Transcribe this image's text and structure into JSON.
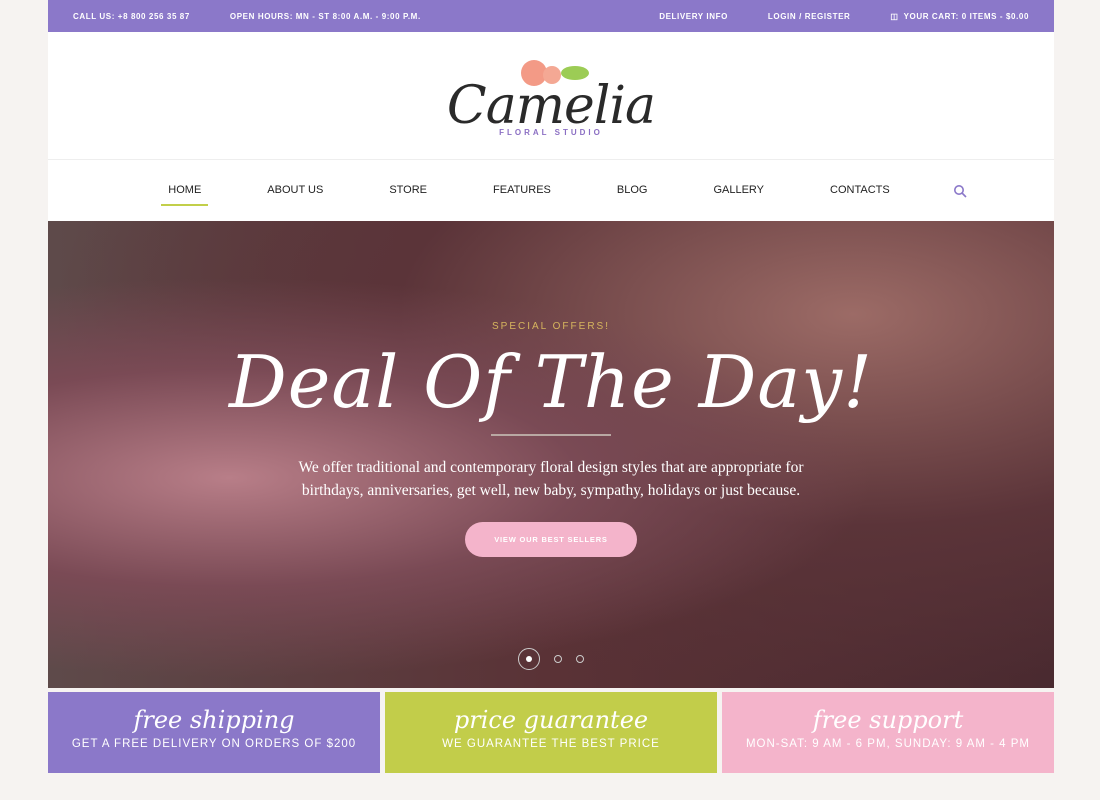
{
  "topbar": {
    "phone": "CALL US: +8 800 256 35 87",
    "hours": "OPEN HOURS: MN - ST 8:00 A.M. - 9:00 P.M.",
    "delivery": "DELIVERY INFO",
    "login": "LOGIN / REGISTER",
    "cart": "YOUR CART:  0 ITEMS - $0.00"
  },
  "logo": {
    "name": "Camelia",
    "tagline": "FLORAL STUDIO"
  },
  "nav": {
    "items": [
      {
        "label": "HOME"
      },
      {
        "label": "ABOUT US"
      },
      {
        "label": "STORE"
      },
      {
        "label": "FEATURES"
      },
      {
        "label": "BLOG"
      },
      {
        "label": "GALLERY"
      },
      {
        "label": "CONTACTS"
      }
    ]
  },
  "hero": {
    "pre": "SPECIAL OFFERS!",
    "title": "Deal Of The Day!",
    "text": "We offer traditional and contemporary floral design styles that are appropriate for birthdays, anniversaries, get well, new baby, sympathy, holidays or just because.",
    "button": "VIEW OUR BEST SELLERS",
    "slides": 3,
    "active_slide": 1
  },
  "features": [
    {
      "title": "free shipping",
      "desc": "GET A FREE DELIVERY ON ORDERS OF $200",
      "color": "#8b78c9"
    },
    {
      "title": "price guarantee",
      "desc": "WE GUARANTEE THE BEST PRICE",
      "color": "#c2cd4a"
    },
    {
      "title": "free support",
      "desc": "MON-SAT: 9 AM - 6 PM, SUNDAY: 9 AM - 4 PM",
      "color": "#f4b4cb"
    }
  ],
  "colors": {
    "accent": "#8b78c9",
    "green": "#c2cd4a",
    "pink": "#f4b4cb"
  }
}
